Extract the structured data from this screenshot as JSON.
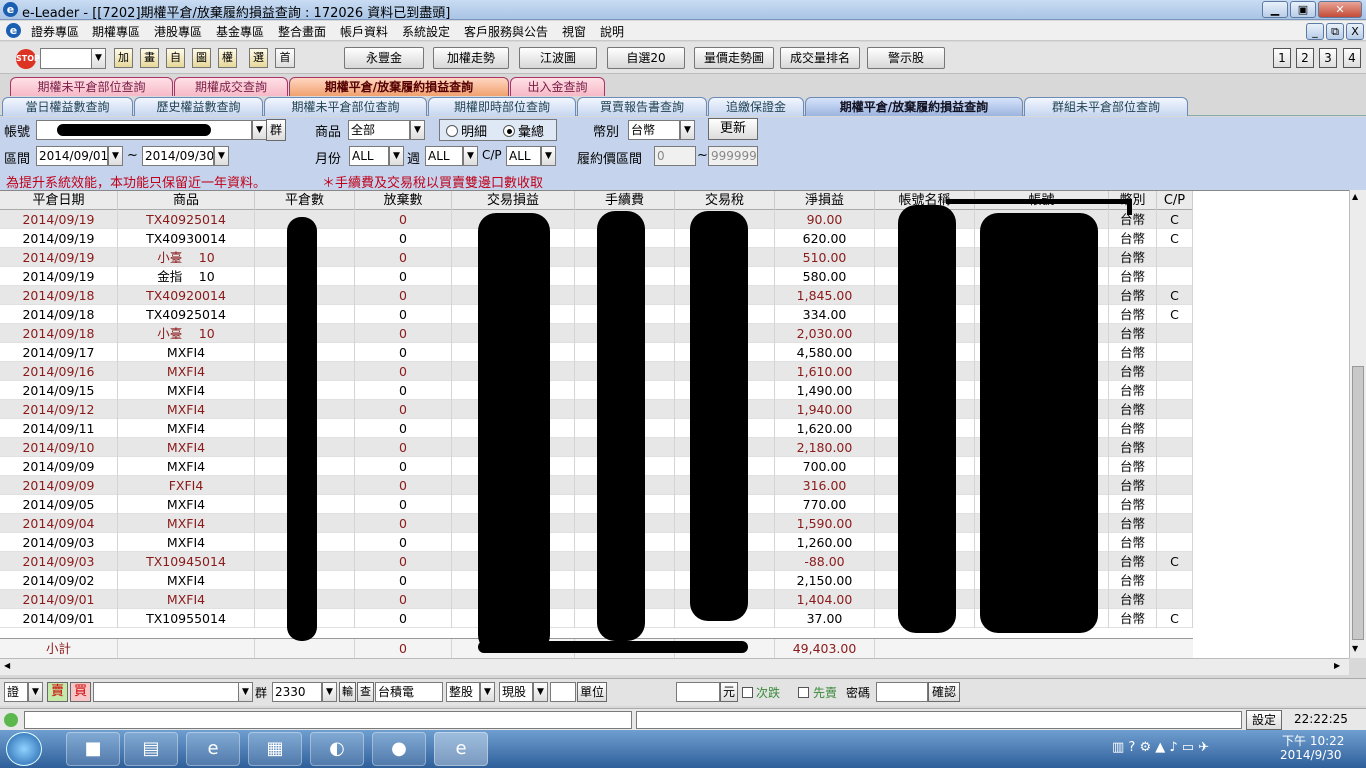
{
  "window": {
    "title": "e-Leader - [[7202]期權平倉/放棄履約損益查詢 : 172026 資料已到盡頭]",
    "minimize": "▁",
    "restore": "▣",
    "close": "✕"
  },
  "menu": [
    "證券專區",
    "期權專區",
    "港股專區",
    "基金專區",
    "整合畫面",
    "帳戶資料",
    "系統設定",
    "客戶服務與公告",
    "視窗",
    "說明"
  ],
  "mdi_controls": {
    "minimize": "_",
    "restore": "⧉",
    "close": "X"
  },
  "toolbar": {
    "icons": [
      "加",
      "畫",
      "自",
      "圖",
      "權",
      "選",
      "首"
    ],
    "buttons": [
      "永豐金",
      "加權走勢",
      "江波圖",
      "自選20",
      "量價走勢圖",
      "成交量排名",
      "警示股"
    ],
    "numbers": [
      "1",
      "2",
      "3",
      "4"
    ]
  },
  "tabs_row1": [
    "期權未平倉部位查詢",
    "期權成交查詢",
    "期權平倉/放棄履約損益查詢",
    "出入金查詢"
  ],
  "tabs_row2": [
    "當日權益數查詢",
    "歷史權益數查詢",
    "期權未平倉部位查詢",
    "期權即時部位查詢",
    "買賣報告書查詢",
    "追繳保證金",
    "期權平倉/放棄履約損益查詢",
    "群組未平倉部位查詢"
  ],
  "form": {
    "account_label": "帳號",
    "group_button": "群",
    "product_label": "商品",
    "product_value": "全部",
    "detail_label": "明細",
    "summary_label": "彙總",
    "currency_label": "幣別",
    "currency_value": "台幣",
    "refresh_button": "更新",
    "period_label": "區間",
    "date_from": "2014/09/01",
    "tilde": "~",
    "date_to": "2014/09/30",
    "month_label": "月份",
    "month_value": "ALL",
    "week_label": "週",
    "week_value": "ALL",
    "cp_label": "C/P",
    "cp_value": "ALL",
    "strike_label": "履約價區間",
    "strike_from": "0",
    "strike_to": "999999"
  },
  "notices": {
    "left": "為提升系統效能，本功能只保留近一年資料。",
    "right": "＊手續費及交易稅以買賣雙邊口數收取"
  },
  "table": {
    "columns": [
      "平倉日期",
      "商品",
      "平倉數",
      "放棄數",
      "交易損益",
      "手續費",
      "交易稅",
      "淨損益",
      "帳號名稱",
      "帳號",
      "幣別",
      "C/P"
    ],
    "rows": [
      {
        "date": "2014/09/19",
        "product": "TX40925014",
        "abandon": "0",
        "net": "90.00",
        "currency": "台幣",
        "cp": "C"
      },
      {
        "date": "2014/09/19",
        "product": "TX40930014",
        "abandon": "0",
        "net": "620.00",
        "currency": "台幣",
        "cp": "C"
      },
      {
        "date": "2014/09/19",
        "product": "小臺　 10",
        "abandon": "0",
        "net": "510.00",
        "currency": "台幣",
        "cp": ""
      },
      {
        "date": "2014/09/19",
        "product": "金指　 10",
        "abandon": "0",
        "net": "580.00",
        "currency": "台幣",
        "cp": ""
      },
      {
        "date": "2014/09/18",
        "product": "TX40920014",
        "abandon": "0",
        "net": "1,845.00",
        "currency": "台幣",
        "cp": "C"
      },
      {
        "date": "2014/09/18",
        "product": "TX40925014",
        "abandon": "0",
        "net": "334.00",
        "currency": "台幣",
        "cp": "C"
      },
      {
        "date": "2014/09/18",
        "product": "小臺　 10",
        "abandon": "0",
        "net": "2,030.00",
        "currency": "台幣",
        "cp": ""
      },
      {
        "date": "2014/09/17",
        "product": "MXFI4",
        "abandon": "0",
        "net": "4,580.00",
        "currency": "台幣",
        "cp": ""
      },
      {
        "date": "2014/09/16",
        "product": "MXFI4",
        "abandon": "0",
        "net": "1,610.00",
        "currency": "台幣",
        "cp": ""
      },
      {
        "date": "2014/09/15",
        "product": "MXFI4",
        "abandon": "0",
        "net": "1,490.00",
        "currency": "台幣",
        "cp": ""
      },
      {
        "date": "2014/09/12",
        "product": "MXFI4",
        "abandon": "0",
        "net": "1,940.00",
        "currency": "台幣",
        "cp": ""
      },
      {
        "date": "2014/09/11",
        "product": "MXFI4",
        "abandon": "0",
        "net": "1,620.00",
        "currency": "台幣",
        "cp": ""
      },
      {
        "date": "2014/09/10",
        "product": "MXFI4",
        "abandon": "0",
        "net": "2,180.00",
        "currency": "台幣",
        "cp": ""
      },
      {
        "date": "2014/09/09",
        "product": "MXFI4",
        "abandon": "0",
        "net": "700.00",
        "currency": "台幣",
        "cp": ""
      },
      {
        "date": "2014/09/09",
        "product": "FXFI4",
        "abandon": "0",
        "net": "316.00",
        "currency": "台幣",
        "cp": ""
      },
      {
        "date": "2014/09/05",
        "product": "MXFI4",
        "abandon": "0",
        "net": "770.00",
        "currency": "台幣",
        "cp": ""
      },
      {
        "date": "2014/09/04",
        "product": "MXFI4",
        "abandon": "0",
        "net": "1,590.00",
        "currency": "台幣",
        "cp": ""
      },
      {
        "date": "2014/09/03",
        "product": "MXFI4",
        "abandon": "0",
        "net": "1,260.00",
        "currency": "台幣",
        "cp": ""
      },
      {
        "date": "2014/09/03",
        "product": "TX10945014",
        "abandon": "0",
        "net": "-88.00",
        "currency": "台幣",
        "cp": "C"
      },
      {
        "date": "2014/09/02",
        "product": "MXFI4",
        "abandon": "0",
        "net": "2,150.00",
        "currency": "台幣",
        "cp": ""
      },
      {
        "date": "2014/09/01",
        "product": "MXFI4",
        "abandon": "0",
        "net": "1,404.00",
        "currency": "台幣",
        "cp": ""
      },
      {
        "date": "2014/09/01",
        "product": "TX10955014",
        "abandon": "0",
        "net": "37.00",
        "currency": "台幣",
        "cp": "C"
      }
    ],
    "total": {
      "label": "小計",
      "abandon": "0",
      "net": "49,403.00"
    }
  },
  "order_bar": {
    "type": "證",
    "buy": "賣",
    "sell": "買",
    "group": "群",
    "stock_code": "2330",
    "input_btn": "輸",
    "query_btn": "查",
    "stock_name": "台積電",
    "lot_type": "整股",
    "trade_type": "現股",
    "unit_label": "單位",
    "price_unit": "元",
    "next_day": "次跌",
    "first_sell": "先賣",
    "password_label": "密碼",
    "confirm_button": "確認"
  },
  "status_bar": {
    "settings": "設定",
    "time": "22:22:25"
  },
  "taskbar": {
    "clock_time": "下午 10:22",
    "clock_date": "2014/9/30",
    "apps": [
      "ie-icon",
      "folder-icon",
      "chrome-icon",
      "media-icon",
      "vpn-icon",
      "firefox-icon",
      "eleader-icon"
    ]
  }
}
